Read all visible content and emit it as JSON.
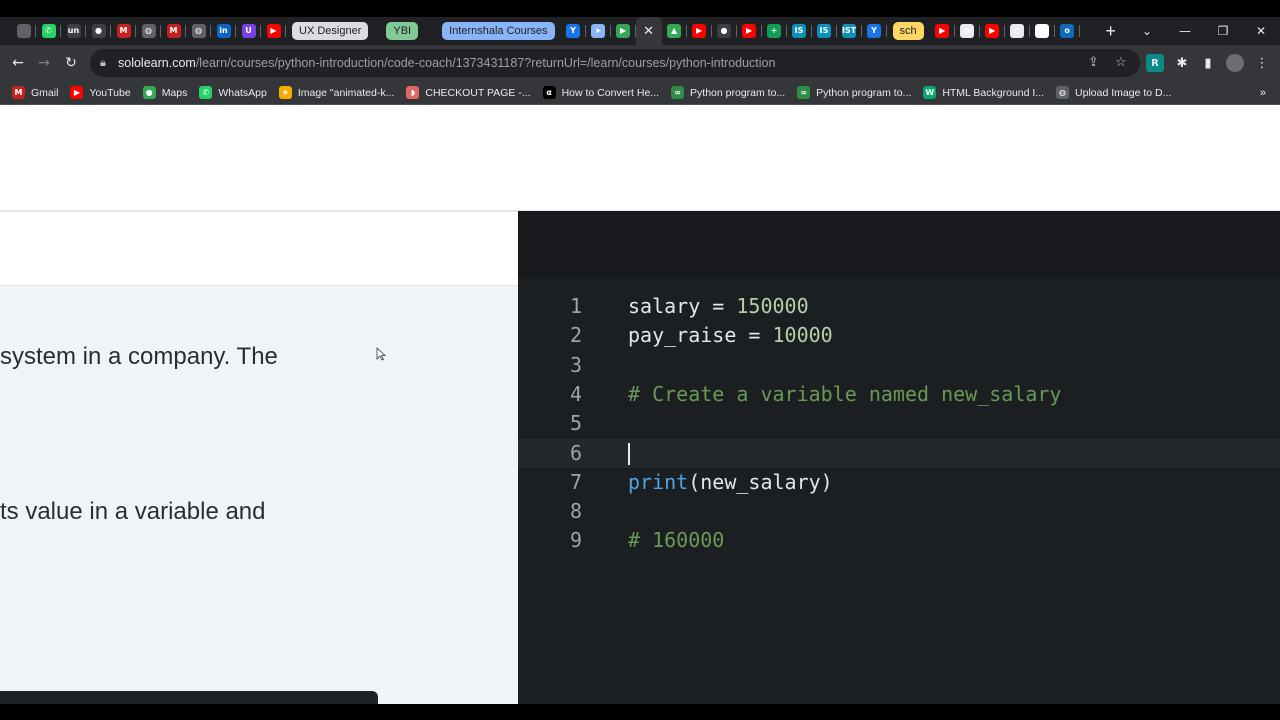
{
  "browser": {
    "pinned_tabs_left": [
      {
        "icon": "chromium-icon",
        "glyph": "",
        "color": "#5f6368"
      },
      {
        "icon": "whatsapp-icon",
        "glyph": "✆",
        "color": "#25d366"
      },
      {
        "icon": "unstop-icon",
        "glyph": "un",
        "color": "#3c4043"
      },
      {
        "icon": "github-icon",
        "glyph": "●",
        "color": "#3c4043"
      },
      {
        "icon": "gmail-icon",
        "glyph": "M",
        "color": "#c5221f"
      },
      {
        "icon": "globe-icon",
        "glyph": "◍",
        "color": "#5f6368"
      },
      {
        "icon": "gmail-icon",
        "glyph": "M",
        "color": "#c5221f"
      },
      {
        "icon": "globe-icon",
        "glyph": "◍",
        "color": "#5f6368"
      },
      {
        "icon": "linkedin-icon",
        "glyph": "in",
        "color": "#0a66c2"
      },
      {
        "icon": "unstop-u-icon",
        "glyph": "U",
        "color": "#7b3fe4"
      },
      {
        "icon": "youtube-icon",
        "glyph": "▶",
        "color": "#ff0000"
      }
    ],
    "tab_groups": [
      {
        "label": "UX Designer",
        "color": "#dadce0"
      },
      {
        "label": "YBI",
        "color": "#81c995"
      },
      {
        "label": "Internshala Courses",
        "color": "#8ab4f8"
      }
    ],
    "pinned_tabs_right": [
      {
        "icon": "vector-icon",
        "glyph": "Y",
        "color": "#1a73e8"
      },
      {
        "icon": "send-icon",
        "glyph": "➤",
        "color": "#8ab4f8"
      },
      {
        "icon": "play-store-icon",
        "glyph": "▶",
        "color": "#34a853"
      }
    ],
    "pinned_tabs_after": [
      {
        "icon": "android-icon",
        "glyph": "▲",
        "color": "#34a853"
      },
      {
        "icon": "youtube-icon",
        "glyph": "▶",
        "color": "#ff0000"
      },
      {
        "icon": "github-icon",
        "glyph": "●",
        "color": "#3c4043"
      },
      {
        "icon": "youtube-icon",
        "glyph": "▶",
        "color": "#ff0000"
      },
      {
        "icon": "sheets-icon",
        "glyph": "+",
        "color": "#0f9d58"
      },
      {
        "icon": "is-icon",
        "glyph": "IS",
        "color": "#0d8fbf"
      },
      {
        "icon": "is-icon",
        "glyph": "IS",
        "color": "#0d8fbf"
      },
      {
        "icon": "ist-icon",
        "glyph": "IST",
        "color": "#0d8fbf"
      },
      {
        "icon": "vector-icon",
        "glyph": "Y",
        "color": "#1a73e8"
      }
    ],
    "group_sch": {
      "label": "sch",
      "color": "#fdd663"
    },
    "pinned_tabs_end": [
      {
        "icon": "youtube-icon",
        "glyph": "▶",
        "color": "#ff0000"
      },
      {
        "icon": "image-icon",
        "glyph": "▤",
        "color": "#e8eaed"
      },
      {
        "icon": "youtube-icon",
        "glyph": "▶",
        "color": "#ff0000"
      },
      {
        "icon": "circle-icon",
        "glyph": "○",
        "color": "#e8eaed"
      },
      {
        "icon": "doc-icon",
        "glyph": "▭",
        "color": "#ffffff"
      },
      {
        "icon": "outlook-icon",
        "glyph": "o",
        "color": "#0f6cbd"
      }
    ],
    "active_tab_close": "✕",
    "new_tab": "+",
    "window_controls": [
      "⌄",
      "—",
      "❐",
      "✕"
    ],
    "url_domain": "sololearn.com",
    "url_path": "/learn/courses/python-introduction/code-coach/1373431187?returnUrl=/learn/courses/python-introduction",
    "bookmarks": [
      {
        "label": "Gmail",
        "icon": "gmail-icon",
        "glyph": "M",
        "color": "#c5221f"
      },
      {
        "label": "YouTube",
        "icon": "youtube-icon",
        "glyph": "▶",
        "color": "#ff0000"
      },
      {
        "label": "Maps",
        "icon": "maps-icon",
        "glyph": "●",
        "color": "#34a853"
      },
      {
        "label": "WhatsApp",
        "icon": "whatsapp-icon",
        "glyph": "✆",
        "color": "#25d366"
      },
      {
        "label": "Image \"animated-k...",
        "icon": "star-icon",
        "glyph": "★",
        "color": "#f9ab00"
      },
      {
        "label": "CHECKOUT PAGE -...",
        "icon": "lips-icon",
        "glyph": "◗",
        "color": "#e06666"
      },
      {
        "label": "How to Convert He...",
        "icon": "alpha-icon",
        "glyph": "α",
        "color": "#000000"
      },
      {
        "label": "Python program to...",
        "icon": "gfg-icon",
        "glyph": "∞",
        "color": "#2f8d46"
      },
      {
        "label": "Python program to...",
        "icon": "gfg-icon",
        "glyph": "∞",
        "color": "#2f8d46"
      },
      {
        "label": "HTML Background I...",
        "icon": "w3-icon",
        "glyph": "W",
        "color": "#04aa6d"
      },
      {
        "label": "Upload Image to D...",
        "icon": "globe-icon",
        "glyph": "◍",
        "color": "#5f6368"
      }
    ],
    "bookmarks_more": "»"
  },
  "task": {
    "line1": "system in a company. The",
    "line2": "ts value in a variable and"
  },
  "editor": {
    "lines": [
      {
        "n": "1",
        "text": "salary = 150000"
      },
      {
        "n": "2",
        "text": "pay_raise = 10000"
      },
      {
        "n": "3",
        "text": ""
      },
      {
        "n": "4",
        "text": "# Create a variable named new_salary"
      },
      {
        "n": "5",
        "text": ""
      },
      {
        "n": "6",
        "text": ""
      },
      {
        "n": "7",
        "text": "print(new_salary)"
      },
      {
        "n": "8",
        "text": ""
      },
      {
        "n": "9",
        "text": "# 160000"
      }
    ],
    "active_line": "6"
  }
}
